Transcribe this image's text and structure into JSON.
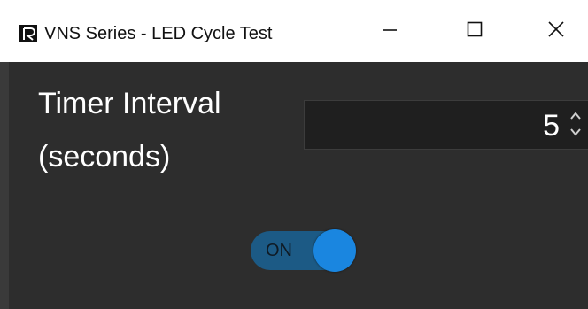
{
  "window": {
    "title": "VNS Series - LED Cycle Test",
    "controls": {
      "minimize": "minimize-icon",
      "maximize": "maximize-icon",
      "close": "close-icon"
    }
  },
  "timer": {
    "label_line1": "Timer Interval",
    "label_line2": "(seconds)",
    "value": "5"
  },
  "toggle": {
    "label": "ON",
    "state": "on",
    "accent": "#1a86e0"
  },
  "colors": {
    "background": "#2d2d2d",
    "titlebar": "#ffffff",
    "track": "#1c5a85"
  }
}
